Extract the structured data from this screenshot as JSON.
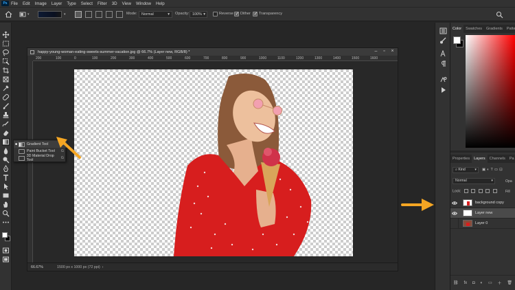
{
  "menubar": {
    "logo": "Ps",
    "items": [
      "File",
      "Edit",
      "Image",
      "Layer",
      "Type",
      "Select",
      "Filter",
      "3D",
      "View",
      "Window",
      "Help"
    ]
  },
  "options": {
    "mode_label": "Mode:",
    "mode_value": "Normal",
    "opacity_label": "Opacity:",
    "opacity_value": "100%",
    "reverse_label": "Reverse",
    "dither_label": "Dither",
    "transparency_label": "Transparency",
    "reverse_checked": false,
    "dither_checked": true,
    "transparency_checked": true,
    "gradient_colors": [
      "#0d1a33",
      "#0a1020",
      "#171717"
    ]
  },
  "tool_flyout": {
    "items": [
      {
        "label": "Gradient Tool",
        "key": "G",
        "selected": true
      },
      {
        "label": "Paint Bucket Tool",
        "key": "G",
        "selected": false
      },
      {
        "label": "3D Material Drop Tool",
        "key": "G",
        "selected": false
      }
    ]
  },
  "document": {
    "title": "happy-young-woman-eating-sweets-summer-vacation.jpg @ 66.7% (Layer new, RGB/8) *",
    "ruler_ticks": [
      "200",
      "100",
      "0",
      "100",
      "200",
      "300",
      "400",
      "500",
      "600",
      "700",
      "800",
      "900",
      "1000",
      "1100",
      "1200",
      "1300",
      "1400",
      "1500",
      "1600"
    ],
    "zoom": "66.67%",
    "dimensions": "1500 px x 1000 px (72 ppi)"
  },
  "color_panel": {
    "tabs": [
      "Color",
      "Swatches",
      "Gradients",
      "Patte"
    ],
    "active_tab": "Color",
    "foreground": "#ffffff",
    "background": "#000000",
    "hue": "#ff0000"
  },
  "layers_panel": {
    "tabs": [
      "Properties",
      "Layers",
      "Channels",
      "Pa"
    ],
    "active_tab": "Layers",
    "kind_label": "Kind",
    "blend_mode": "Normal",
    "opacity_label": "Opa",
    "lock_label": "Lock:",
    "fill_label": "Fill",
    "layers": [
      {
        "name": "background copy",
        "visible": true,
        "selected": false
      },
      {
        "name": "Layer new",
        "visible": true,
        "selected": true
      },
      {
        "name": "Layer 0",
        "visible": false,
        "selected": false
      }
    ],
    "footer_icons": [
      "link-icon",
      "fx-icon",
      "mask-icon",
      "adjustment-icon",
      "group-icon",
      "new-layer-icon",
      "trash-icon"
    ],
    "footer_glyphs": [
      "⛓",
      "fx",
      "◘",
      "◐",
      "▭",
      "＋",
      "🗑"
    ]
  },
  "annotations": {
    "arrow_color": "#f5a623"
  }
}
